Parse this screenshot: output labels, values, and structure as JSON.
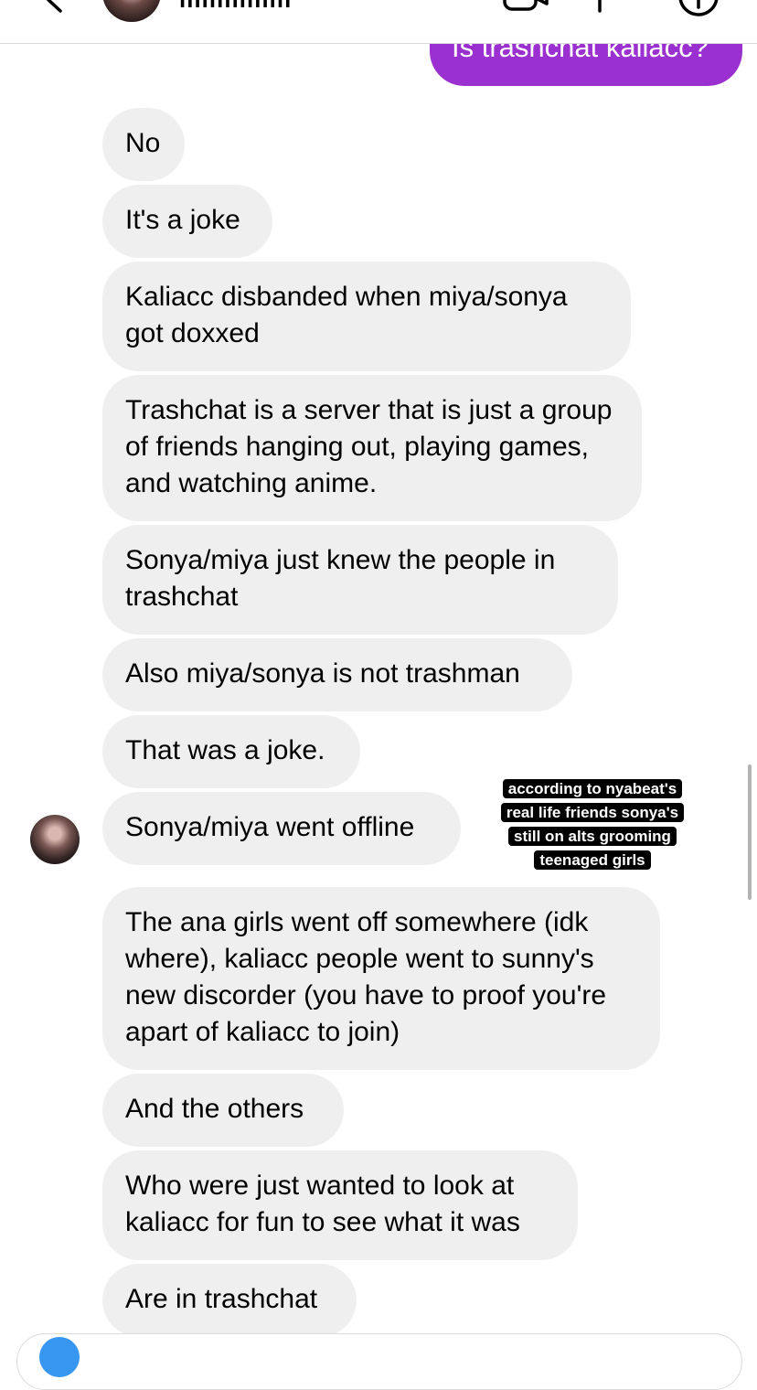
{
  "header": {
    "contact_name": "lllllllllllllll"
  },
  "messages": {
    "sent": "Is trashchat kaliacc?",
    "received": [
      "No",
      "It's a joke",
      "Kaliacc disbanded when miya/sonya got doxxed",
      "Trashchat is a server that is just a group of friends hanging out, playing games, and watching anime.",
      "Sonya/miya just knew the people in trashchat",
      "Also miya/sonya is not trashman",
      "That was a joke.",
      "Sonya/miya went offline",
      "The ana girls went off somewhere (idk where), kaliacc people went to sunny's new discorder (you have to proof you're apart of kaliacc to join)",
      "And the others",
      "Who were just wanted to look at kaliacc for fun to see what it was",
      "Are in trashchat"
    ]
  },
  "annotation": {
    "lines": [
      "according to nyabeat's",
      "real life friends sonya's",
      "still on alts grooming",
      "teenaged girls"
    ]
  },
  "colors": {
    "sent_bubble": "#9b30d0",
    "received_bubble": "#efefef",
    "camera_button": "#3797f0"
  },
  "icons": [
    "back-chevron-icon",
    "video-call-icon",
    "phone-icon",
    "info-icon",
    "camera-icon"
  ]
}
